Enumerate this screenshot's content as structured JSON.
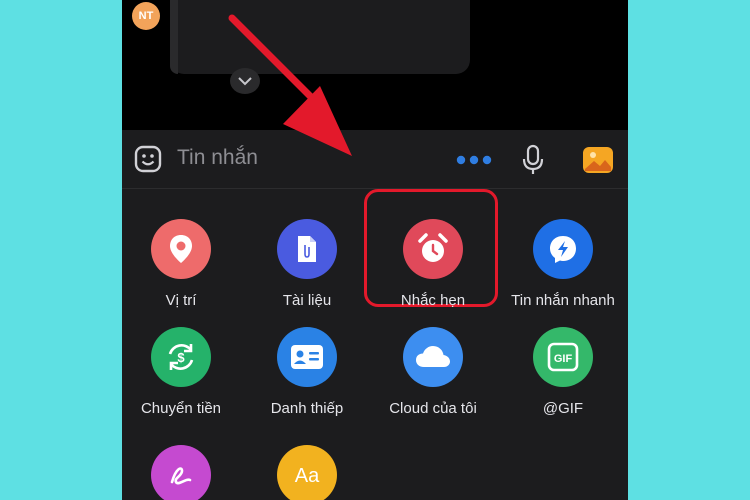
{
  "chat": {
    "avatar_initials": "NT"
  },
  "composer": {
    "placeholder": "Tin nhắn",
    "icons": [
      "emoji-icon",
      "more-icon",
      "microphone-icon",
      "photo-icon"
    ]
  },
  "panel": {
    "items": [
      {
        "label": "Vị trí",
        "icon": "location-icon",
        "color": "#ee6b6b"
      },
      {
        "label": "Tài liệu",
        "icon": "document-icon",
        "color": "#4a5be0"
      },
      {
        "label": "Nhắc hẹn",
        "icon": "alarm-icon",
        "color": "#e0495a"
      },
      {
        "label": "Tin nhắn nhanh",
        "icon": "quick-message-icon",
        "color": "#1f6fe5"
      },
      {
        "label": "Chuyển tiền",
        "icon": "money-transfer-icon",
        "color": "#25b26a"
      },
      {
        "label": "Danh thiếp",
        "icon": "contact-card-icon",
        "color": "#2a82e5"
      },
      {
        "label": "Cloud của tôi",
        "icon": "cloud-icon",
        "color": "#3d8ef0"
      },
      {
        "label": "@GIF",
        "icon": "gif-icon",
        "color": "#34b86a"
      },
      {
        "label": "",
        "icon": "handwriting-icon",
        "color": "#c54ad0"
      },
      {
        "label": "",
        "icon": "font-style-icon",
        "color": "#f2b21f"
      }
    ]
  },
  "annotation": {
    "highlight_color": "#e3192b",
    "arrow_color": "#e3192b"
  }
}
